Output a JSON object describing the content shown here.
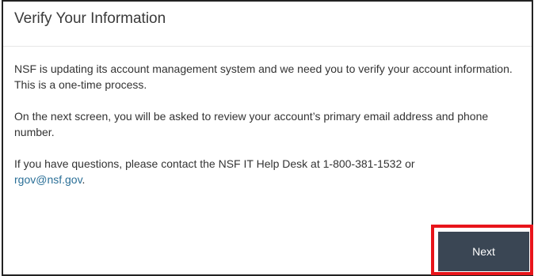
{
  "panel": {
    "title": "Verify Your Information"
  },
  "body": {
    "paragraph_1": "NSF is updating its account management system and we need you to verify your account information. This is a one-time process.",
    "paragraph_2": "On the next screen, you will be asked to review your account’s primary email address and phone number.",
    "paragraph_3_text": "If you have questions, please contact the NSF IT Help Desk at 1-800-381-1532 or",
    "paragraph_3_email": "rgov@nsf.gov",
    "paragraph_3_end": "."
  },
  "actions": {
    "next_label": "Next"
  },
  "colors": {
    "highlight": "#e8141a",
    "button_bg": "#3a4654",
    "link": "#2a6f97"
  }
}
